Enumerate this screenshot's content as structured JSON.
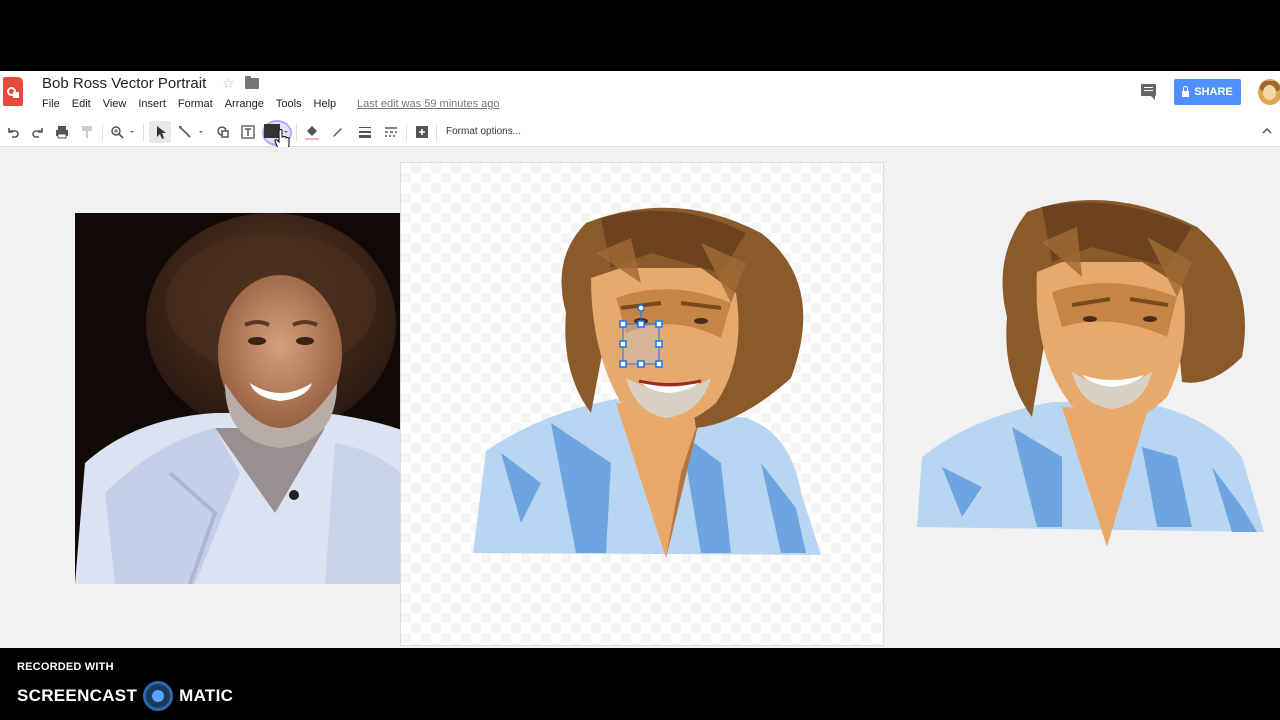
{
  "doc": {
    "title": "Bob Ross Vector Portrait",
    "last_edit": "Last edit was 59 minutes ago"
  },
  "menu": [
    "File",
    "Edit",
    "View",
    "Insert",
    "Format",
    "Arrange",
    "Tools",
    "Help"
  ],
  "header": {
    "share_label": "SHARE"
  },
  "toolbar": {
    "format_options": "Format options...",
    "icons": [
      "undo-icon",
      "redo-icon",
      "print-icon",
      "paint-format-icon",
      "zoom-icon",
      "select-icon",
      "line-icon",
      "shape-icon",
      "textbox-icon",
      "image-icon",
      "fill-color-icon",
      "line-color-icon",
      "line-weight-icon",
      "line-dash-icon",
      "insert-icon"
    ]
  },
  "recording": {
    "label": "RECORDED WITH",
    "brand_left": "SCREENCAST",
    "brand_right": "MATIC"
  },
  "colors": {
    "share": "#4d90fe",
    "hair": "#7a4a1a",
    "shirt": "#a9cdf0",
    "skin": "#e2a066",
    "selection": "#1a73e8"
  }
}
